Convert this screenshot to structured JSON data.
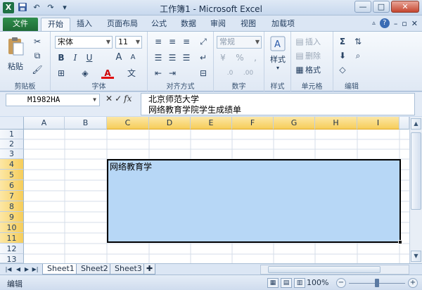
{
  "window": {
    "title": "工作簿1 - Microsoft Excel",
    "app_icon": "X",
    "controls": [
      "—",
      "□",
      "✕"
    ]
  },
  "qat": {
    "save": "save-icon",
    "undo": "↶",
    "redo": "↷",
    "customize": "▾"
  },
  "ribbon_tabs": [
    {
      "label": "文件",
      "active": false
    },
    {
      "label": "开始",
      "active": true
    },
    {
      "label": "插入",
      "active": false
    },
    {
      "label": "页面布局",
      "active": false
    },
    {
      "label": "公式",
      "active": false
    },
    {
      "label": "数据",
      "active": false
    },
    {
      "label": "审阅",
      "active": false
    },
    {
      "label": "视图",
      "active": false
    },
    {
      "label": "加载项",
      "active": false
    }
  ],
  "ribbon": {
    "clipboard": {
      "label": "剪贴板",
      "paste": "粘贴"
    },
    "font": {
      "label": "字体",
      "name": "宋体",
      "size": "11",
      "bold": "B",
      "italic": "I",
      "underline": "U",
      "grow": "A",
      "shrink": "A"
    },
    "alignment": {
      "label": "对齐方式"
    },
    "number": {
      "label": "数字",
      "format": "常规",
      "currency": "¥",
      "percent": "%",
      "comma": ",",
      "inc_dec": ".0",
      "dec_dec": ".00"
    },
    "styles": {
      "label": "样式",
      "button": "样式"
    },
    "cells": {
      "label": "单元格",
      "insert": "插入",
      "delete": "删除",
      "format": "格式"
    },
    "editing": {
      "label": "编辑",
      "sum": "Σ"
    }
  },
  "formula_bar": {
    "name_box": "M1982HA",
    "fx": "fx",
    "content_line1": "北京师范大学",
    "content_line2": "网络教育学院学生成绩单"
  },
  "grid": {
    "columns": [
      "A",
      "B",
      "C",
      "D",
      "E",
      "F",
      "G",
      "H",
      "I"
    ],
    "selected_columns": [
      "C",
      "D",
      "E",
      "F",
      "G",
      "H",
      "I"
    ],
    "rows": [
      "1",
      "2",
      "3",
      "4",
      "5",
      "6",
      "7",
      "8",
      "9",
      "10",
      "11",
      "12",
      "13"
    ],
    "selected_rows": [
      "4",
      "5",
      "6",
      "7",
      "8",
      "9",
      "10",
      "11"
    ],
    "cell_text": "网络教育学"
  },
  "sheets": {
    "tabs": [
      "Sheet1",
      "Sheet2",
      "Sheet3"
    ],
    "active": "Sheet1"
  },
  "status": {
    "mode": "编辑",
    "zoom": "100%",
    "zoom_minus": "−",
    "zoom_plus": "+"
  },
  "colors": {
    "selection_fill": "#b7d7f6",
    "header_selected": "#f6cd5a",
    "file_tab": "#1f6b36"
  }
}
